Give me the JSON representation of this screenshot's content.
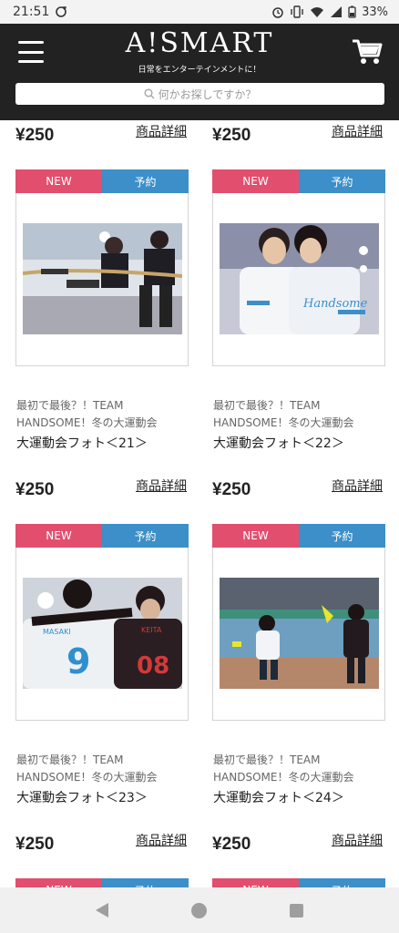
{
  "status": {
    "time": "21:51",
    "battery": "33%"
  },
  "header": {
    "logo": "A!SMART",
    "tagline": "日常をエンターテインメントに！"
  },
  "search": {
    "placeholder": "何かお探しですか？"
  },
  "top_row": {
    "price_left": "¥250",
    "price_right": "¥250",
    "detail_left": "商品詳細",
    "detail_right": "商品詳細"
  },
  "products": [
    {
      "badge_new": "NEW",
      "badge_reserve": "予約",
      "series": "最初で最後？！TEAM HANDSOME！冬の大運動会",
      "name": "大運動会フォト＜21＞",
      "price": "¥250",
      "detail": "商品詳細"
    },
    {
      "badge_new": "NEW",
      "badge_reserve": "予約",
      "series": "最初で最後？！TEAM HANDSOME！冬の大運動会",
      "name": "大運動会フォト＜22＞",
      "price": "¥250",
      "detail": "商品詳細"
    },
    {
      "badge_new": "NEW",
      "badge_reserve": "予約",
      "series": "最初で最後？！TEAM HANDSOME！冬の大運動会",
      "name": "大運動会フォト＜23＞",
      "price": "¥250",
      "detail": "商品詳細"
    },
    {
      "badge_new": "NEW",
      "badge_reserve": "予約",
      "series": "最初で最後？！TEAM HANDSOME！冬の大運動会",
      "name": "大運動会フォト＜24＞",
      "price": "¥250",
      "detail": "商品詳細"
    }
  ],
  "bottom_row": {
    "badge_new": "NEW",
    "badge_reserve": "予約"
  },
  "colors": {
    "header_bg": "#222222",
    "badge_new": "#e24e6e",
    "badge_reserve": "#3c8fc8"
  }
}
